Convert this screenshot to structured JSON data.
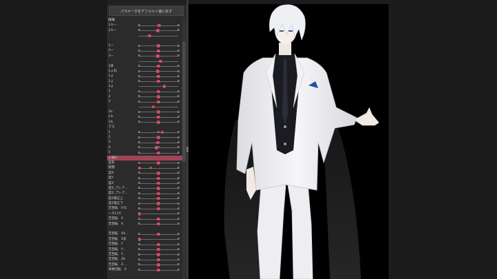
{
  "panel": {
    "reset_button_label": "パラメータをデフォルト値に戻す"
  },
  "colors": {
    "accent_knob": "#d64d6a",
    "selected_row": "#9e4656",
    "panel_bg": "#2b2b2b",
    "canvas_bg": "#000000"
  },
  "params": [
    {
      "label": "情報",
      "header": true
    },
    {
      "label": "1ルー",
      "ticks": [
        0,
        0.5,
        1
      ],
      "knob": 0.52
    },
    {
      "label": "2ルー",
      "ticks": [
        0,
        0.5,
        1
      ],
      "knob": 0.48
    },
    {
      "label": "",
      "ticks": [],
      "knob": 0.27
    },
    {
      "label": "",
      "header": true
    },
    {
      "label": "1ー",
      "ticks": [
        0,
        0.5,
        1
      ],
      "knob": 0.5
    },
    {
      "label": "2ー",
      "ticks": [
        0,
        0.5,
        1
      ],
      "knob": 0.5
    },
    {
      "label": "3ー",
      "ticks": [
        0,
        0.5,
        1
      ],
      "knob": 0.48
    },
    {
      "label": "",
      "ticks": [],
      "knob": 0.55
    },
    {
      "label": "1目",
      "ticks": [
        0,
        0.5,
        1
      ],
      "knob": 0.5
    },
    {
      "label": "2ょ白",
      "ticks": [
        0,
        0.5,
        1
      ],
      "knob": 0.48
    },
    {
      "label": "1ょ",
      "ticks": [
        0,
        0.5,
        1
      ],
      "knob": 0.5
    },
    {
      "label": "2ょ",
      "ticks": [
        0,
        0.5,
        1
      ],
      "knob": 0.5
    },
    {
      "label": "3ょ",
      "ticks": [],
      "knob": 0.65
    },
    {
      "label": "1",
      "ticks": [
        0,
        0.5,
        1
      ],
      "knob": 0.5
    },
    {
      "label": "2",
      "ticks": [
        0,
        0.5,
        1
      ],
      "knob": 0.5
    },
    {
      "label": "3",
      "ticks": [
        0,
        0.5,
        1
      ],
      "knob": 0.5
    },
    {
      "label": "",
      "ticks": [],
      "knob": 0.37
    },
    {
      "label": "1b",
      "ticks": [
        0,
        0.5,
        1
      ],
      "knob": 0.5
    },
    {
      "label": "2ｂ",
      "ticks": [
        0,
        0.5,
        1
      ],
      "knob": 0.5
    },
    {
      "label": "3ｂ",
      "ticks": [
        0,
        0.5,
        1
      ],
      "knob": 0.5
    },
    {
      "label": "アス",
      "header": true
    },
    {
      "label": "1",
      "ticks": [
        0,
        0.5,
        1
      ],
      "knob": 0.6
    },
    {
      "label": "2",
      "ticks": [
        0,
        0.5,
        1
      ],
      "knob": 0.5
    },
    {
      "label": "3",
      "ticks": [
        0,
        0.5,
        1
      ],
      "knob": 0.48
    },
    {
      "label": "4",
      "ticks": [
        0,
        0.5,
        1
      ],
      "knob": 0.45
    },
    {
      "label": "5",
      "ticks": [
        0,
        0.5,
        1
      ],
      "knob": 0.5
    },
    {
      "label": "ｅ角X",
      "selected": true,
      "ticks": [],
      "knob": null
    },
    {
      "label": "変形",
      "ticks": [
        0,
        1
      ],
      "knob": 0.5
    },
    {
      "label": "開閉",
      "ticks": [
        0.3,
        1
      ],
      "knob": 0.02
    },
    {
      "label": "度X",
      "ticks": [
        0,
        1
      ],
      "knob": 0.5
    },
    {
      "label": "度Y",
      "ticks": [
        0,
        1
      ],
      "knob": 0.5
    },
    {
      "label": "度Z",
      "ticks": [
        0,
        1
      ],
      "knob": 0.5
    },
    {
      "label": "度X_プレア...",
      "ticks": [
        0,
        1
      ],
      "knob": 0.5
    },
    {
      "label": "度Z_プレア...",
      "ticks": [
        0,
        1
      ],
      "knob": 0.5
    },
    {
      "label": "度Z補正上",
      "ticks": [
        0,
        1
      ],
      "knob": 0.5
    },
    {
      "label": "度Z補正下",
      "ticks": [
        0,
        1
      ],
      "knob": 0.5
    },
    {
      "label": "吉回転　FX1",
      "ticks": [
        0,
        1
      ],
      "knob": 0.5
    },
    {
      "label": "ータ170",
      "ticks": [
        0,
        1
      ],
      "knob": 0.02
    },
    {
      "label": "吉回転　X",
      "ticks": [
        0,
        1
      ],
      "knob": 0.5
    },
    {
      "label": "吉回転　X",
      "ticks": [
        0,
        1
      ],
      "knob": 0.5
    },
    {
      "label": "",
      "header": true
    },
    {
      "label": "吉回転　XX...",
      "ticks": [
        0,
        1
      ],
      "knob": 0.5
    },
    {
      "label": "吉回転　X反",
      "ticks": [
        0,
        1
      ],
      "knob": 0.02
    },
    {
      "label": "吉回転　Y",
      "ticks": [
        0,
        1
      ],
      "knob": 0.5
    },
    {
      "label": "吉回転　Y...",
      "ticks": [
        0,
        1
      ],
      "knob": 0.5
    },
    {
      "label": "吉回転　Y...",
      "ticks": [
        0,
        1
      ],
      "knob": 0.5
    },
    {
      "label": "吉回転　Zb",
      "ticks": [
        0,
        1
      ],
      "knob": 0.5
    },
    {
      "label": "吉回転　Z...",
      "ticks": [
        0,
        1
      ],
      "knob": 0.5
    },
    {
      "label": "演奏回転　X",
      "ticks": [
        0,
        1
      ],
      "knob": 0.5
    }
  ]
}
